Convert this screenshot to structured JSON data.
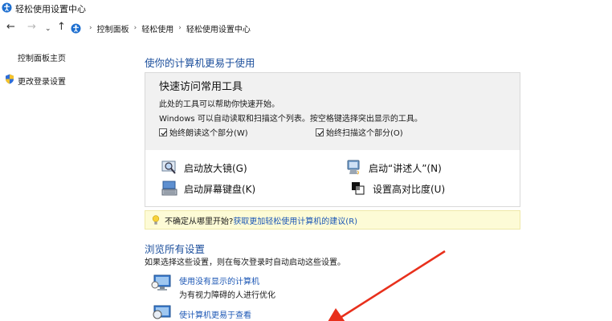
{
  "window": {
    "title": "轻松使用设置中心"
  },
  "breadcrumb": [
    "控制面板",
    "轻松使用",
    "轻松使用设置中心"
  ],
  "sidebar": {
    "items": [
      {
        "label": "控制面板主页"
      },
      {
        "label": "更改登录设置"
      }
    ]
  },
  "main": {
    "title": "使你的计算机更易于使用",
    "quick_access": {
      "heading": "快速访问常用工具",
      "desc1": "此处的工具可以帮助你快速开始。",
      "desc2": "Windows 可以自动读取和扫描这个列表。按空格键选择突出显示的工具。",
      "checkbox_read": "始终朗读这个部分(W)",
      "checkbox_scan": "始终扫描这个部分(O)",
      "tools": [
        {
          "label": "启动放大镜(G)",
          "icon": "magnifier-icon"
        },
        {
          "label": "启动“讲述人”(N)",
          "icon": "narrator-icon"
        },
        {
          "label": "启动屏幕键盘(K)",
          "icon": "keyboard-icon"
        },
        {
          "label": "设置高对比度(U)",
          "icon": "contrast-icon"
        }
      ]
    },
    "hint": {
      "prefix": "不确定从哪里开始?",
      "link": "获取更加轻松使用计算机的建议(R)"
    },
    "browse": {
      "title": "浏览所有设置",
      "desc": "如果选择这些设置，则在每次登录时自动启动这些设置。",
      "options": [
        {
          "link": "使用没有显示的计算机",
          "desc": "为有视力障碍的人进行优化",
          "icon": "monitor-icon"
        },
        {
          "link": "使计算机更易于查看",
          "icon": "display-icon"
        }
      ]
    }
  },
  "colors": {
    "link": "#1c57b5",
    "heading": "#1c4f9c",
    "hint_bg": "#fdfbd6",
    "arrow": "#e8301c"
  }
}
